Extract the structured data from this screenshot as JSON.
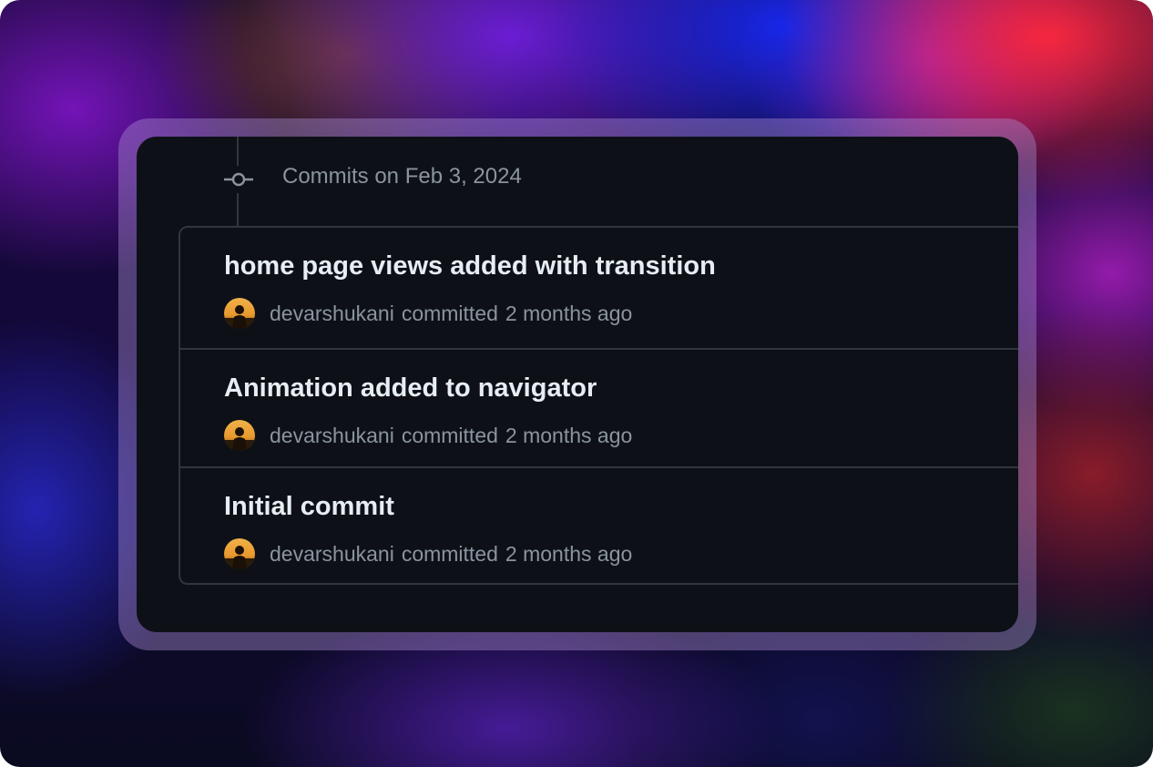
{
  "commit_group": {
    "header": "Commits on Feb 3, 2024"
  },
  "commits": [
    {
      "title": "home page views added with transition",
      "author": "devarshukani",
      "action": "committed",
      "time": "2 months ago"
    },
    {
      "title": "Animation added to navigator",
      "author": "devarshukani",
      "action": "committed",
      "time": "2 months ago"
    },
    {
      "title": "Initial commit",
      "author": "devarshukani",
      "action": "committed",
      "time": "2 months ago"
    }
  ],
  "icons": {
    "commit_node": "git-commit-icon",
    "avatar": "user-avatar"
  },
  "colors": {
    "panel_background": "#0d1117",
    "border": "#30363d",
    "title_text": "#e6edf3",
    "muted_text": "#8b949e"
  }
}
